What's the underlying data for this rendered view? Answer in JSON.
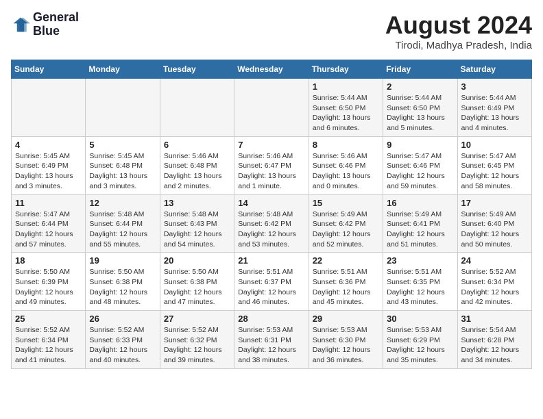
{
  "header": {
    "logo_line1": "General",
    "logo_line2": "Blue",
    "month_title": "August 2024",
    "location": "Tirodi, Madhya Pradesh, India"
  },
  "days_of_week": [
    "Sunday",
    "Monday",
    "Tuesday",
    "Wednesday",
    "Thursday",
    "Friday",
    "Saturday"
  ],
  "weeks": [
    [
      {
        "day": "",
        "info": ""
      },
      {
        "day": "",
        "info": ""
      },
      {
        "day": "",
        "info": ""
      },
      {
        "day": "",
        "info": ""
      },
      {
        "day": "1",
        "info": "Sunrise: 5:44 AM\nSunset: 6:50 PM\nDaylight: 13 hours\nand 6 minutes."
      },
      {
        "day": "2",
        "info": "Sunrise: 5:44 AM\nSunset: 6:50 PM\nDaylight: 13 hours\nand 5 minutes."
      },
      {
        "day": "3",
        "info": "Sunrise: 5:44 AM\nSunset: 6:49 PM\nDaylight: 13 hours\nand 4 minutes."
      }
    ],
    [
      {
        "day": "4",
        "info": "Sunrise: 5:45 AM\nSunset: 6:49 PM\nDaylight: 13 hours\nand 3 minutes."
      },
      {
        "day": "5",
        "info": "Sunrise: 5:45 AM\nSunset: 6:48 PM\nDaylight: 13 hours\nand 3 minutes."
      },
      {
        "day": "6",
        "info": "Sunrise: 5:46 AM\nSunset: 6:48 PM\nDaylight: 13 hours\nand 2 minutes."
      },
      {
        "day": "7",
        "info": "Sunrise: 5:46 AM\nSunset: 6:47 PM\nDaylight: 13 hours\nand 1 minute."
      },
      {
        "day": "8",
        "info": "Sunrise: 5:46 AM\nSunset: 6:46 PM\nDaylight: 13 hours\nand 0 minutes."
      },
      {
        "day": "9",
        "info": "Sunrise: 5:47 AM\nSunset: 6:46 PM\nDaylight: 12 hours\nand 59 minutes."
      },
      {
        "day": "10",
        "info": "Sunrise: 5:47 AM\nSunset: 6:45 PM\nDaylight: 12 hours\nand 58 minutes."
      }
    ],
    [
      {
        "day": "11",
        "info": "Sunrise: 5:47 AM\nSunset: 6:44 PM\nDaylight: 12 hours\nand 57 minutes."
      },
      {
        "day": "12",
        "info": "Sunrise: 5:48 AM\nSunset: 6:44 PM\nDaylight: 12 hours\nand 55 minutes."
      },
      {
        "day": "13",
        "info": "Sunrise: 5:48 AM\nSunset: 6:43 PM\nDaylight: 12 hours\nand 54 minutes."
      },
      {
        "day": "14",
        "info": "Sunrise: 5:48 AM\nSunset: 6:42 PM\nDaylight: 12 hours\nand 53 minutes."
      },
      {
        "day": "15",
        "info": "Sunrise: 5:49 AM\nSunset: 6:42 PM\nDaylight: 12 hours\nand 52 minutes."
      },
      {
        "day": "16",
        "info": "Sunrise: 5:49 AM\nSunset: 6:41 PM\nDaylight: 12 hours\nand 51 minutes."
      },
      {
        "day": "17",
        "info": "Sunrise: 5:49 AM\nSunset: 6:40 PM\nDaylight: 12 hours\nand 50 minutes."
      }
    ],
    [
      {
        "day": "18",
        "info": "Sunrise: 5:50 AM\nSunset: 6:39 PM\nDaylight: 12 hours\nand 49 minutes."
      },
      {
        "day": "19",
        "info": "Sunrise: 5:50 AM\nSunset: 6:38 PM\nDaylight: 12 hours\nand 48 minutes."
      },
      {
        "day": "20",
        "info": "Sunrise: 5:50 AM\nSunset: 6:38 PM\nDaylight: 12 hours\nand 47 minutes."
      },
      {
        "day": "21",
        "info": "Sunrise: 5:51 AM\nSunset: 6:37 PM\nDaylight: 12 hours\nand 46 minutes."
      },
      {
        "day": "22",
        "info": "Sunrise: 5:51 AM\nSunset: 6:36 PM\nDaylight: 12 hours\nand 45 minutes."
      },
      {
        "day": "23",
        "info": "Sunrise: 5:51 AM\nSunset: 6:35 PM\nDaylight: 12 hours\nand 43 minutes."
      },
      {
        "day": "24",
        "info": "Sunrise: 5:52 AM\nSunset: 6:34 PM\nDaylight: 12 hours\nand 42 minutes."
      }
    ],
    [
      {
        "day": "25",
        "info": "Sunrise: 5:52 AM\nSunset: 6:34 PM\nDaylight: 12 hours\nand 41 minutes."
      },
      {
        "day": "26",
        "info": "Sunrise: 5:52 AM\nSunset: 6:33 PM\nDaylight: 12 hours\nand 40 minutes."
      },
      {
        "day": "27",
        "info": "Sunrise: 5:52 AM\nSunset: 6:32 PM\nDaylight: 12 hours\nand 39 minutes."
      },
      {
        "day": "28",
        "info": "Sunrise: 5:53 AM\nSunset: 6:31 PM\nDaylight: 12 hours\nand 38 minutes."
      },
      {
        "day": "29",
        "info": "Sunrise: 5:53 AM\nSunset: 6:30 PM\nDaylight: 12 hours\nand 36 minutes."
      },
      {
        "day": "30",
        "info": "Sunrise: 5:53 AM\nSunset: 6:29 PM\nDaylight: 12 hours\nand 35 minutes."
      },
      {
        "day": "31",
        "info": "Sunrise: 5:54 AM\nSunset: 6:28 PM\nDaylight: 12 hours\nand 34 minutes."
      }
    ]
  ]
}
